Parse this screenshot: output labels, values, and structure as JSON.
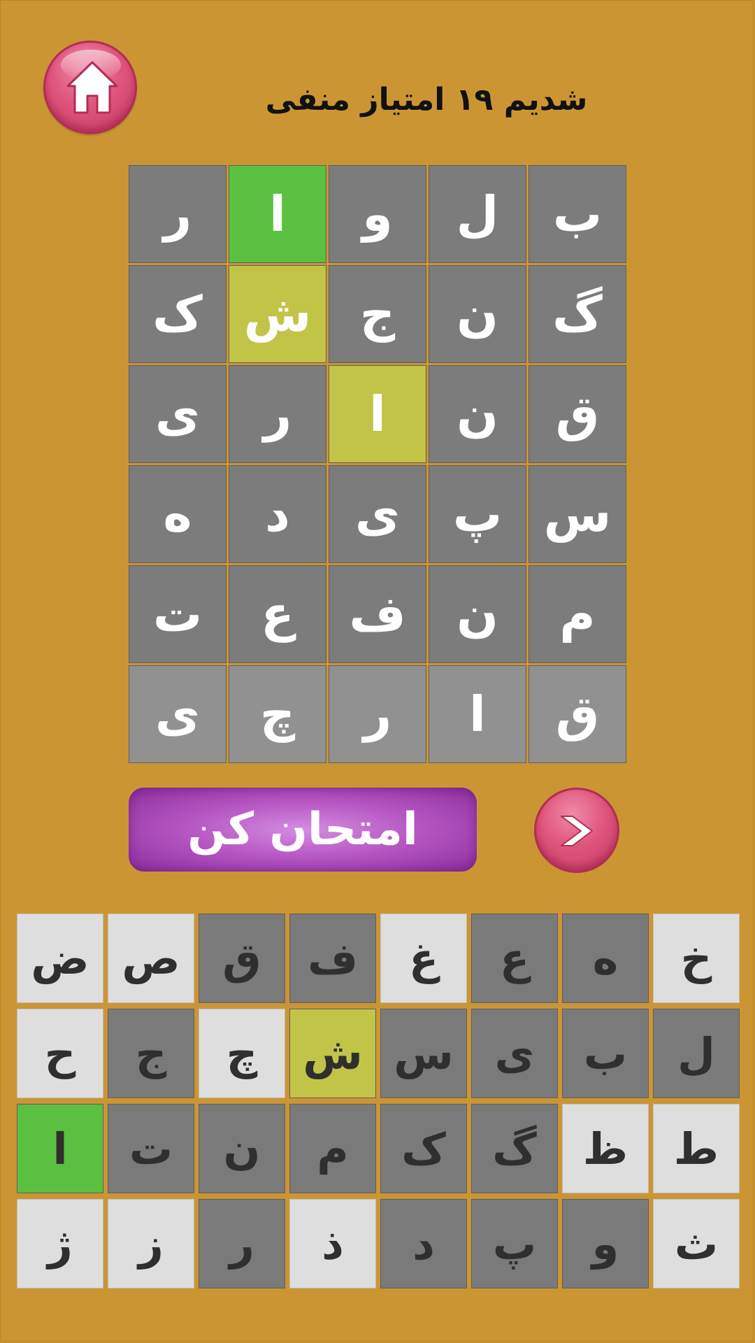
{
  "header": {
    "title": "شدیم ۱۹ امتیاز منفی"
  },
  "colors": {
    "background": "#cc9534",
    "tile_default": "#7c7c7c",
    "tile_correct": "#5bc040",
    "tile_present": "#c2c448",
    "key_unused": "#dedede",
    "button_purple": "#b758c4",
    "button_pink": "#e0557d"
  },
  "icons": {
    "home": "home-icon",
    "next": "chevron-right-icon"
  },
  "board": {
    "rows": [
      [
        {
          "l": "ب",
          "s": "default"
        },
        {
          "l": "ل",
          "s": "default"
        },
        {
          "l": "و",
          "s": "default"
        },
        {
          "l": "ا",
          "s": "correct"
        },
        {
          "l": "ر",
          "s": "default"
        }
      ],
      [
        {
          "l": "گ",
          "s": "default"
        },
        {
          "l": "ن",
          "s": "default"
        },
        {
          "l": "ج",
          "s": "default"
        },
        {
          "l": "ش",
          "s": "present"
        },
        {
          "l": "ک",
          "s": "default"
        }
      ],
      [
        {
          "l": "ق",
          "s": "default"
        },
        {
          "l": "ن",
          "s": "default"
        },
        {
          "l": "ا",
          "s": "present"
        },
        {
          "l": "ر",
          "s": "default"
        },
        {
          "l": "ی",
          "s": "default"
        }
      ],
      [
        {
          "l": "س",
          "s": "default"
        },
        {
          "l": "پ",
          "s": "default"
        },
        {
          "l": "ی",
          "s": "default"
        },
        {
          "l": "د",
          "s": "default"
        },
        {
          "l": "ه",
          "s": "default"
        }
      ],
      [
        {
          "l": "م",
          "s": "default"
        },
        {
          "l": "ن",
          "s": "default"
        },
        {
          "l": "ف",
          "s": "default"
        },
        {
          "l": "ع",
          "s": "default"
        },
        {
          "l": "ت",
          "s": "default"
        }
      ],
      [
        {
          "l": "ق",
          "s": "current"
        },
        {
          "l": "ا",
          "s": "current"
        },
        {
          "l": "ر",
          "s": "current"
        },
        {
          "l": "چ",
          "s": "current"
        },
        {
          "l": "ی",
          "s": "current"
        }
      ]
    ]
  },
  "actions": {
    "submit_label": "امتحان کن"
  },
  "keyboard": {
    "rows": [
      [
        {
          "l": "خ",
          "s": "unused"
        },
        {
          "l": "ه",
          "s": "absent"
        },
        {
          "l": "ع",
          "s": "absent"
        },
        {
          "l": "غ",
          "s": "unused"
        },
        {
          "l": "ف",
          "s": "absent"
        },
        {
          "l": "ق",
          "s": "absent"
        },
        {
          "l": "ص",
          "s": "unused"
        },
        {
          "l": "ض",
          "s": "unused"
        }
      ],
      [
        {
          "l": "ل",
          "s": "absent"
        },
        {
          "l": "ب",
          "s": "absent"
        },
        {
          "l": "ی",
          "s": "absent"
        },
        {
          "l": "س",
          "s": "absent"
        },
        {
          "l": "ش",
          "s": "present"
        },
        {
          "l": "چ",
          "s": "unused"
        },
        {
          "l": "ج",
          "s": "absent"
        },
        {
          "l": "ح",
          "s": "unused"
        }
      ],
      [
        {
          "l": "ط",
          "s": "unused"
        },
        {
          "l": "ظ",
          "s": "unused"
        },
        {
          "l": "گ",
          "s": "absent"
        },
        {
          "l": "ک",
          "s": "absent"
        },
        {
          "l": "م",
          "s": "absent"
        },
        {
          "l": "ن",
          "s": "absent"
        },
        {
          "l": "ت",
          "s": "absent"
        },
        {
          "l": "ا",
          "s": "correct"
        }
      ],
      [
        {
          "l": "ث",
          "s": "unused"
        },
        {
          "l": "و",
          "s": "absent"
        },
        {
          "l": "پ",
          "s": "absent"
        },
        {
          "l": "د",
          "s": "absent"
        },
        {
          "l": "ذ",
          "s": "unused"
        },
        {
          "l": "ر",
          "s": "absent"
        },
        {
          "l": "ز",
          "s": "unused"
        },
        {
          "l": "ژ",
          "s": "unused"
        }
      ]
    ]
  }
}
